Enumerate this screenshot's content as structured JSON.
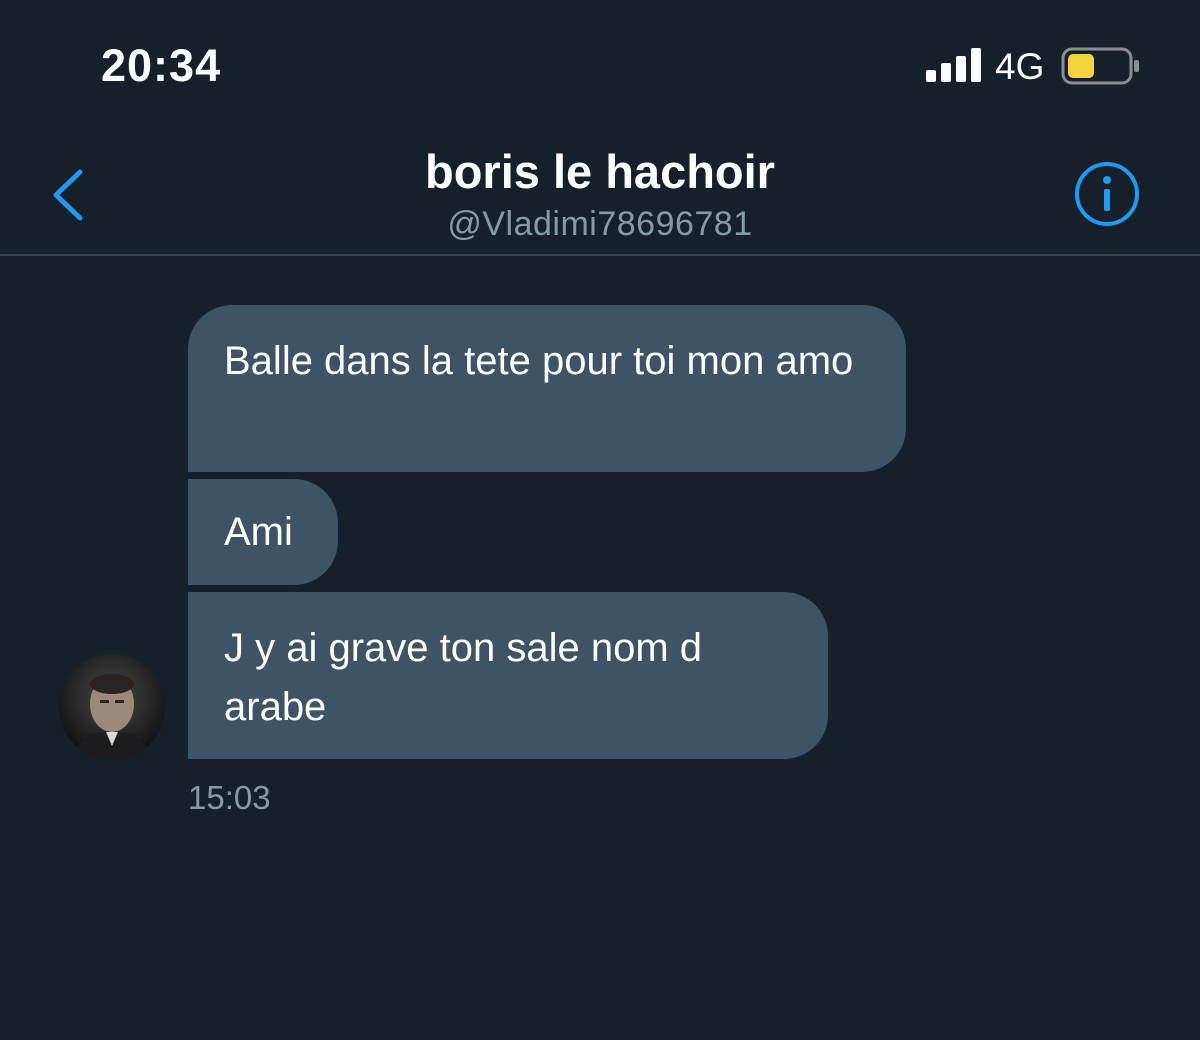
{
  "status_bar": {
    "time": "20:34",
    "network": "4G",
    "signal_icon": "signal-bars-icon",
    "battery_icon": "battery-low-icon",
    "battery_fill_color": "#f5d33c"
  },
  "header": {
    "contact_name": "boris le hachoir",
    "contact_handle": "@Vladimi78696781",
    "back_icon": "chevron-left-icon",
    "info_icon": "info-icon",
    "accent_color": "#1d9bf0"
  },
  "conversation": {
    "messages": [
      {
        "text": "Balle dans la tete pour toi mon amo"
      },
      {
        "text": "Ami"
      },
      {
        "text": "J y ai grave ton sale nom d arabe"
      }
    ],
    "timestamp": "15:03"
  },
  "colors": {
    "background": "#15202b",
    "bubble": "#3d5466",
    "secondary_text": "#8899a6",
    "divider": "#38444d"
  }
}
